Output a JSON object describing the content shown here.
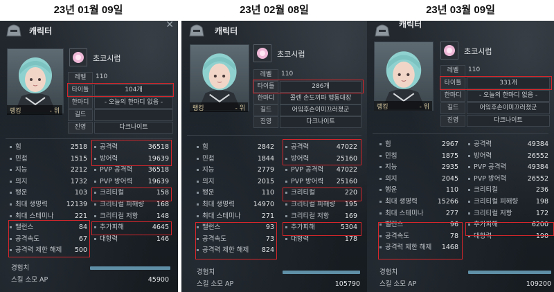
{
  "dates": [
    "23년 01월 09일",
    "23년 02월 08일",
    "23년 03월 09일"
  ],
  "panels": [
    {
      "title": "캐릭터",
      "name": "초코시럽",
      "rank_label": "랭킹",
      "rank_value": "- 위",
      "info": {
        "level_label": "레벨",
        "level": "110",
        "titles_label": "타이틀",
        "titles": "104개",
        "motto_label": "한마디",
        "motto": "- 오늘의 한마디 없음 -",
        "guild_label": "길드",
        "guild": "",
        "faction_label": "진영",
        "faction": "다크나이트"
      },
      "left_stats": [
        {
          "label": "힘",
          "value": "2518"
        },
        {
          "label": "민첩",
          "value": "1515"
        },
        {
          "label": "지능",
          "value": "2212"
        },
        {
          "label": "의지",
          "value": "1732"
        },
        {
          "label": "행운",
          "value": "103"
        },
        {
          "label": "최대 생명력",
          "value": "12139"
        },
        {
          "label": "최대 스테미나",
          "value": "221"
        },
        {
          "label": "밸런스",
          "value": "84"
        },
        {
          "label": "공격속도",
          "value": "67"
        },
        {
          "label": "공격력 제한 해제",
          "value": "500"
        }
      ],
      "right_stats": [
        {
          "label": "공격력",
          "value": "36518"
        },
        {
          "label": "방어력",
          "value": "19639"
        },
        {
          "label": "PVP 공격력",
          "value": "36518"
        },
        {
          "label": "PVP 방어력",
          "value": "19639"
        },
        {
          "label": "크리티컬",
          "value": "158"
        },
        {
          "label": "크리티컬 피해량",
          "value": "168"
        },
        {
          "label": "크리티컬 저항",
          "value": "148"
        },
        {
          "label": "추가피해",
          "value": "4645"
        },
        {
          "label": "대항력",
          "value": "146"
        }
      ],
      "exp_label": "경험치",
      "exp_dots": "··",
      "ap_label": "스킬 소모 AP",
      "ap_value": "45900"
    },
    {
      "title": "캐릭터",
      "name": "초코시럽",
      "rank_label": "랭킹",
      "rank_value": "- 위",
      "info": {
        "level_label": "레벨",
        "level": "110",
        "titles_label": "타이틀",
        "titles": "286개",
        "motto_label": "한마디",
        "motto": "콜렌 손도끼파 행동대장",
        "guild_label": "길드",
        "guild": "어잌후손이미끄러졌군",
        "faction_label": "진영",
        "faction": "다크나이트"
      },
      "left_stats": [
        {
          "label": "힘",
          "value": "2842"
        },
        {
          "label": "민첩",
          "value": "1844"
        },
        {
          "label": "지능",
          "value": "2779"
        },
        {
          "label": "의지",
          "value": "2015"
        },
        {
          "label": "행운",
          "value": "110"
        },
        {
          "label": "최대 생명력",
          "value": "14970"
        },
        {
          "label": "최대 스테미나",
          "value": "271"
        },
        {
          "label": "밸런스",
          "value": "93"
        },
        {
          "label": "공격속도",
          "value": "73"
        },
        {
          "label": "공격력 제한 해제",
          "value": "824"
        }
      ],
      "right_stats": [
        {
          "label": "공격력",
          "value": "47022"
        },
        {
          "label": "방어력",
          "value": "25160"
        },
        {
          "label": "PVP 공격력",
          "value": "47022"
        },
        {
          "label": "PVP 방어력",
          "value": "25160"
        },
        {
          "label": "크리티컬",
          "value": "220"
        },
        {
          "label": "크리티컬 피해량",
          "value": "195"
        },
        {
          "label": "크리티컬 저항",
          "value": "169"
        },
        {
          "label": "추가피해",
          "value": "5304"
        },
        {
          "label": "대항력",
          "value": "178"
        }
      ],
      "exp_label": "경험치",
      "exp_dots": "··",
      "ap_label": "스킬 소모 AP",
      "ap_value": "105790"
    },
    {
      "title": "캐릭터",
      "name": "초코시럽",
      "rank_label": "랭킹",
      "rank_value": "- 위",
      "info": {
        "level_label": "레벨",
        "level": "110",
        "titles_label": "타이틀",
        "titles": "331개",
        "motto_label": "한마디",
        "motto": "- 오늘의 한마디 없음 -",
        "guild_label": "길드",
        "guild": "어잌후손이미끄러졌군",
        "faction_label": "진영",
        "faction": "다크나이트"
      },
      "left_stats": [
        {
          "label": "힘",
          "value": "2967"
        },
        {
          "label": "민첩",
          "value": "1875"
        },
        {
          "label": "지능",
          "value": "2935"
        },
        {
          "label": "의지",
          "value": "2045"
        },
        {
          "label": "행운",
          "value": "110"
        },
        {
          "label": "최대 생명력",
          "value": "15266"
        },
        {
          "label": "최대 스테미나",
          "value": "277"
        },
        {
          "label": "밸런스",
          "value": "96"
        },
        {
          "label": "공격속도",
          "value": "78"
        },
        {
          "label": "공격력 제한 해제",
          "value": "1468"
        }
      ],
      "right_stats": [
        {
          "label": "공격력",
          "value": "49384"
        },
        {
          "label": "방어력",
          "value": "26552"
        },
        {
          "label": "PVP 공격력",
          "value": "49384"
        },
        {
          "label": "PVP 방어력",
          "value": "26552"
        },
        {
          "label": "크리티컬",
          "value": "236"
        },
        {
          "label": "크리티컬 피해량",
          "value": "198"
        },
        {
          "label": "크리티컬 저항",
          "value": "172"
        },
        {
          "label": "추가피해",
          "value": "6200"
        },
        {
          "label": "대항력",
          "value": "190"
        }
      ],
      "exp_label": "경험치",
      "exp_dots": "··",
      "ap_label": "스킬 소모 AP",
      "ap_value": "109200"
    }
  ]
}
